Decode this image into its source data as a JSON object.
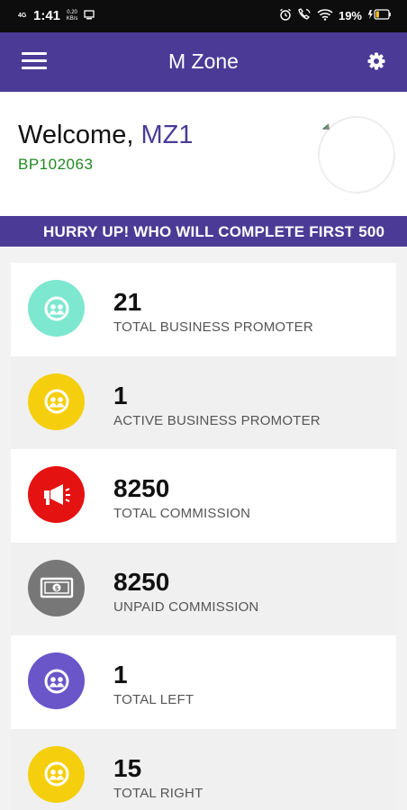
{
  "status_bar": {
    "network": "4G",
    "time": "1:41",
    "speed": "0.20 KB/s",
    "battery": "19%"
  },
  "app_bar": {
    "title": "M Zone",
    "menu_icon": "hamburger-menu-icon",
    "settings_icon": "gear-icon"
  },
  "welcome": {
    "greeting": "Welcome, ",
    "name": "MZ1",
    "member_id": "BP102063"
  },
  "announcement": {
    "text": "HURRY UP! WHO WILL COMPLETE FIRST 500"
  },
  "colors": {
    "primary": "#4b3b96",
    "id_green": "#1f8a1f",
    "teal": "#7de8cf",
    "yellow": "#f5cf0d",
    "red": "#e51212",
    "grey": "#777777",
    "purple": "#6a55c9"
  },
  "stats": [
    {
      "value": "21",
      "label": "TOTAL BUSINESS PROMOTER",
      "icon": "people-icon",
      "color": "#7de8cf"
    },
    {
      "value": "1",
      "label": "ACTIVE BUSINESS PROMOTER",
      "icon": "people-icon",
      "color": "#f5cf0d"
    },
    {
      "value": "8250",
      "label": "TOTAL COMMISSION",
      "icon": "megaphone-icon",
      "color": "#e51212"
    },
    {
      "value": "8250",
      "label": "UNPAID COMMISSION",
      "icon": "cash-icon",
      "color": "#777777"
    },
    {
      "value": "1",
      "label": "TOTAL LEFT",
      "icon": "people-icon",
      "color": "#6a55c9"
    },
    {
      "value": "15",
      "label": "TOTAL RIGHT",
      "icon": "people-icon",
      "color": "#f5cf0d"
    }
  ]
}
